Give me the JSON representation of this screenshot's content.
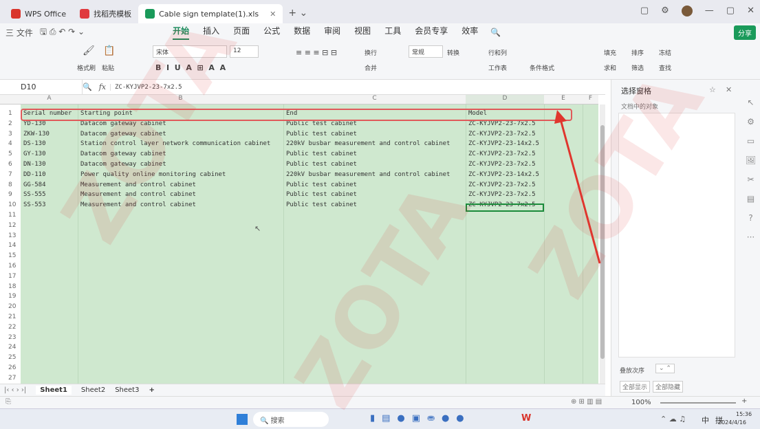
{
  "titlebar": {
    "tabs": [
      {
        "label": "WPS Office",
        "color": "#d9342b"
      },
      {
        "label": "找稻壳模板",
        "color": "#e0393e"
      },
      {
        "label": "Cable sign template(1).xls",
        "color": "#1a9a5a"
      }
    ]
  },
  "menubar": {
    "file": "三 文件",
    "items": [
      "开始",
      "插入",
      "页面",
      "公式",
      "数据",
      "审阅",
      "视图",
      "工具",
      "会员专享",
      "效率"
    ],
    "active": "开始",
    "share": "分享"
  },
  "ribbon": {
    "format_painter": "格式刷",
    "paste": "粘贴",
    "font_name": "宋体",
    "font_size": "12",
    "wrap": "换行",
    "merge": "合并",
    "number_format": "常规",
    "convert": "转换",
    "rows_cols": "行和列",
    "worksheet": "工作表",
    "cond_format": "条件格式",
    "fill": "填充",
    "sort": "排序",
    "freeze": "冻结",
    "sum": "求和",
    "filter": "筛选",
    "find": "查找"
  },
  "formula_bar": {
    "cell_ref": "D10",
    "fx": "fx",
    "value": "ZC-KYJVP2-23-7x2.5"
  },
  "columns": [
    "A",
    "B",
    "C",
    "D",
    "E",
    "F"
  ],
  "rows": [
    [
      "Serial number",
      "Starting point",
      "End",
      "Model"
    ],
    [
      "YD-130",
      "Datacom gateway cabinet",
      "Public test cabinet",
      "ZC-KYJVP2-23-7x2.5"
    ],
    [
      "ZKW-130",
      "Datacom gateway cabinet",
      "Public test cabinet",
      "ZC-KYJVP2-23-7x2.5"
    ],
    [
      "DS-130",
      "Station control layer network communication cabinet",
      "220kV busbar measurement and control cabinet",
      "ZC-KYJVP2-23-14x2.5"
    ],
    [
      "GY-130",
      "Datacom gateway cabinet",
      "Public test cabinet",
      "ZC-KYJVP2-23-7x2.5"
    ],
    [
      "DN-130",
      "Datacom gateway cabinet",
      "Public test cabinet",
      "ZC-KYJVP2-23-7x2.5"
    ],
    [
      "DD-110",
      "Power quality online monitoring cabinet",
      "220kV busbar measurement and control cabinet",
      "ZC-KYJVP2-23-14x2.5"
    ],
    [
      "GG-584",
      "Measurement and control cabinet",
      "Public test cabinet",
      "ZC-KYJVP2-23-7x2.5"
    ],
    [
      "SS-555",
      "Measurement and control cabinet",
      "Public test cabinet",
      "ZC-KYJVP2-23-7x2.5"
    ],
    [
      "SS-553",
      "Measurement and control cabinet",
      "Public test cabinet",
      "ZC-KYJVP2-23-7x2.5"
    ]
  ],
  "row_numbers": [
    "1",
    "2",
    "3",
    "4",
    "5",
    "6",
    "7",
    "8",
    "9",
    "10",
    "11",
    "12",
    "13",
    "14",
    "15",
    "16",
    "17",
    "18",
    "19",
    "20",
    "21",
    "22",
    "23",
    "24",
    "25",
    "26",
    "27"
  ],
  "sheet_tabs": [
    "Sheet1",
    "Sheet2",
    "Sheet3"
  ],
  "active_sheet": "Sheet1",
  "pane": {
    "title": "选择窗格",
    "subtitle": "文档中的对象",
    "order": "叠放次序",
    "show_all": "全部显示",
    "hide_all": "全部隐藏"
  },
  "status": {
    "zoom": "100%"
  },
  "taskbar": {
    "search": "搜索",
    "ime": "中",
    "ime2": "拼",
    "time": "15:36",
    "date": "2024/4/16"
  },
  "watermark": "ZOTA",
  "colors": {
    "accent": "#1a8a5a",
    "highlight": "#d94040",
    "cell_fill": "#cfe8cf"
  }
}
